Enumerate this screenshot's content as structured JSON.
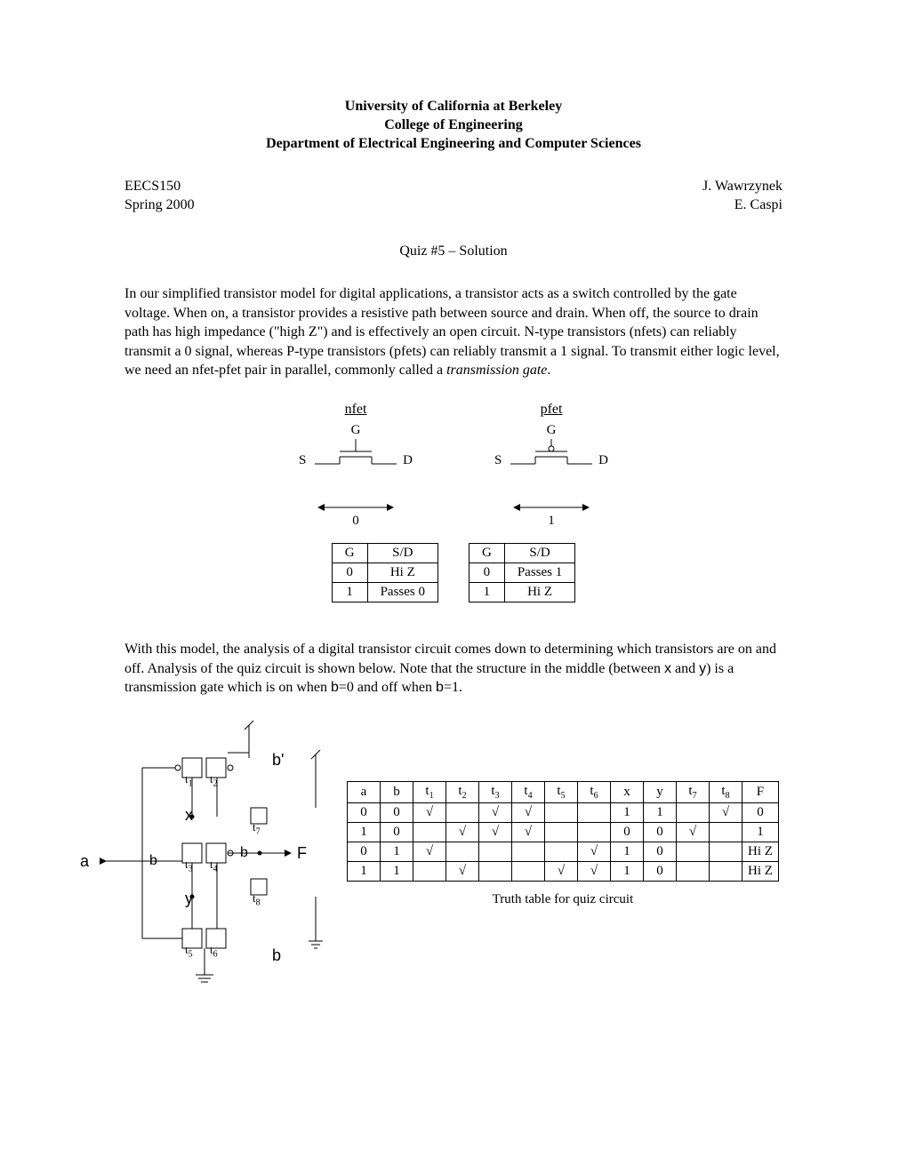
{
  "header": {
    "line1": "University of California at Berkeley",
    "line2": "College of Engineering",
    "line3": "Department of Electrical Engineering and Computer Sciences"
  },
  "meta": {
    "course": "EECS150",
    "term": "Spring 2000",
    "name1": "J. Wawrzynek",
    "name2": "E. Caspi"
  },
  "quiz_title": "Quiz #5 – Solution",
  "para1_a": "In our simplified transistor model for digital applications, a transistor acts as a switch controlled by the gate voltage.  When on, a transistor provides a resistive path between source and drain.  When off, the source to drain path has high impedance (\"high Z\") and is effectively an open circuit.  N-type transistors (nfets) can reliably transmit a 0 signal, whereas P-type transistors (pfets) can reliably transmit a 1 signal.  To transmit either logic level, we need an nfet-pfet pair in parallel, commonly called a ",
  "para1_em": "transmission gate",
  "para1_b": ".",
  "fet": {
    "nfet_title": "nfet",
    "pfet_title": "pfet",
    "G": "G",
    "S": "S",
    "D": "D",
    "nfet_pass": "0",
    "pfet_pass": "1",
    "table_hdr_G": "G",
    "table_hdr_SD": "S/D",
    "nfet_rows": [
      [
        "0",
        "Hi Z"
      ],
      [
        "1",
        "Passes 0"
      ]
    ],
    "pfet_rows": [
      [
        "0",
        "Passes 1"
      ],
      [
        "1",
        "Hi Z"
      ]
    ]
  },
  "para2_a": "With this model, the analysis of a digital transistor circuit comes down to determining which transistors are on and off.  Analysis of the quiz circuit is shown below.  Note that the structure in the middle (between ",
  "para2_x": "x",
  "para2_b": " and ",
  "para2_y": "y",
  "para2_c": ") is a transmission gate which is on when ",
  "para2_bsig": "b",
  "para2_d": "=0 and off when ",
  "para2_bsig2": "b",
  "para2_e": "=1.",
  "circuit_labels": {
    "a_in": "a",
    "b_prime": "b'",
    "b_left": "b",
    "b_mid": "b",
    "b_bot": "b",
    "x": "x",
    "y": "y",
    "F": "F",
    "t1": "t",
    "t1s": "1",
    "t2": "t",
    "t2s": "2",
    "t3": "t",
    "t3s": "3",
    "t4": "t",
    "t4s": "4",
    "t5": "t",
    "t5s": "5",
    "t6": "t",
    "t6s": "6",
    "t7": "t",
    "t7s": "7",
    "t8": "t",
    "t8s": "8"
  },
  "truth": {
    "headers": [
      "a",
      "b",
      "t1",
      "t2",
      "t3",
      "t4",
      "t5",
      "t6",
      "x",
      "y",
      "t7",
      "t8",
      "F"
    ],
    "rows": [
      [
        "0",
        "0",
        "√",
        "",
        "√",
        "√",
        "",
        "",
        "1",
        "1",
        "",
        "√",
        "0"
      ],
      [
        "1",
        "0",
        "",
        "√",
        "√",
        "√",
        "",
        "",
        "0",
        "0",
        "√",
        "",
        "1"
      ],
      [
        "0",
        "1",
        "√",
        "",
        "",
        "",
        "",
        "√",
        "1",
        "0",
        "",
        "",
        "Hi Z"
      ],
      [
        "1",
        "1",
        "",
        "√",
        "",
        "",
        "√",
        "√",
        "1",
        "0",
        "",
        "",
        "Hi Z"
      ]
    ],
    "caption": "Truth table for quiz circuit"
  }
}
